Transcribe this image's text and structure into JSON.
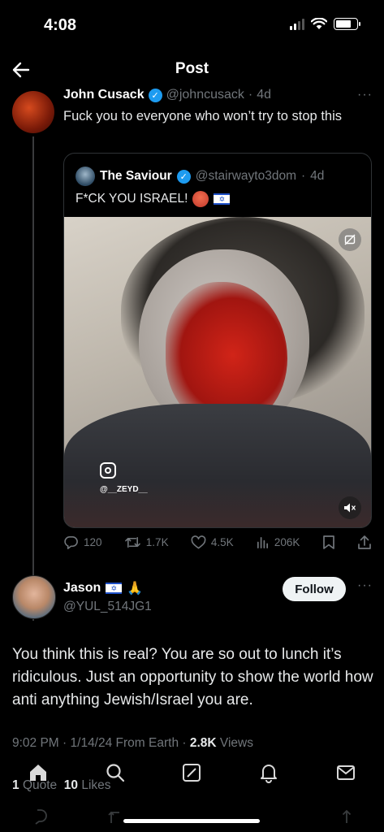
{
  "status_bar": {
    "time": "4:08"
  },
  "nav": {
    "title": "Post"
  },
  "parent_tweet": {
    "name": "John Cusack",
    "handle": "@johncusack",
    "age": "4d",
    "text": "Fuck you  to everyone who won’t  try to stop this",
    "quote": {
      "name": "The Saviour",
      "handle": "@stairwayto3dom",
      "age": "4d",
      "text": "F*CK YOU ISRAEL!",
      "media_watermark": "@__ZEYD__"
    },
    "actions": {
      "replies": "120",
      "retweets": "1.7K",
      "likes": "4.5K",
      "views": "206K"
    }
  },
  "reply": {
    "name": "Jason",
    "handle": "@YUL_514JG1",
    "follow_label": "Follow",
    "text": "You think this is real?  You are so out to lunch it’s ridiculous.  Just an opportunity to show the world how anti anything Jewish/Israel you are.",
    "time": "9:02 PM",
    "date": "1/14/24",
    "source": "From Earth",
    "views_count": "2.8K",
    "views_label": "Views",
    "quotes_count": "1",
    "quotes_label": "Quote",
    "likes_count": "10",
    "likes_label": "Likes"
  },
  "colors": {
    "background": "#000000",
    "text": "#e7e9ea",
    "muted": "#71767b",
    "verified": "#1d9bf0",
    "border": "#2f3336"
  },
  "icons": [
    "back-arrow-icon",
    "verified-icon",
    "more-icon",
    "reply-icon",
    "retweet-icon",
    "like-icon",
    "views-icon",
    "bookmark-icon",
    "share-icon",
    "mute-icon",
    "home-icon",
    "search-icon",
    "grok-icon",
    "notifications-icon",
    "messages-icon"
  ]
}
